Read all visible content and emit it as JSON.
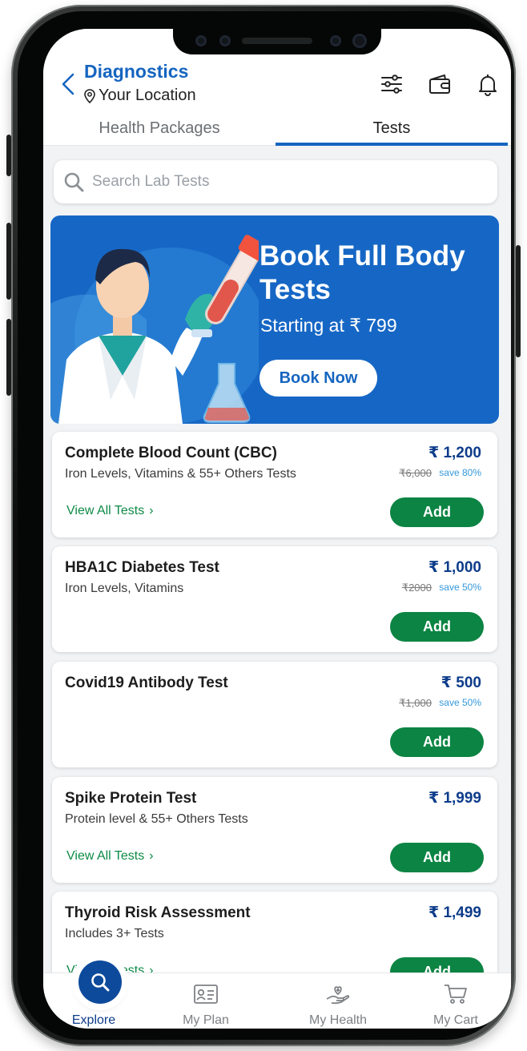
{
  "header": {
    "title": "Diagnostics",
    "location": "Your Location"
  },
  "tabs": [
    {
      "label": "Health Packages",
      "active": false
    },
    {
      "label": "Tests",
      "active": true
    }
  ],
  "search": {
    "placeholder": "Search Lab Tests"
  },
  "banner": {
    "title": "Book Full Body Tests",
    "subtitle": "Starting at ₹ 799",
    "button": "Book Now"
  },
  "tests": [
    {
      "name": "Complete Blood Count (CBC)",
      "description": "Iron Levels, Vitamins & 55+ Others Tests",
      "price": "₹ 1,200",
      "old_price": "₹6,000",
      "save": "save 80%",
      "view_all": "View All Tests",
      "add": "Add"
    },
    {
      "name": "HBA1C Diabetes Test",
      "description": "Iron Levels, Vitamins",
      "price": "₹ 1,000",
      "old_price": "₹2000",
      "save": "save 50%",
      "view_all": "",
      "add": "Add"
    },
    {
      "name": "Covid19 Antibody Test",
      "description": "",
      "price": "₹ 500",
      "old_price": "₹1,000",
      "save": "save 50%",
      "view_all": "",
      "add": "Add"
    },
    {
      "name": "Spike Protein Test",
      "description": "Protein level & 55+ Others Tests",
      "price": "₹ 1,999",
      "old_price": "",
      "save": "",
      "view_all": "View All Tests",
      "add": "Add"
    },
    {
      "name": "Thyroid Risk Assessment",
      "description": "Includes 3+ Tests",
      "price": "₹ 1,499",
      "old_price": "",
      "save": "",
      "view_all": "View All Tests",
      "add": "Add"
    }
  ],
  "bottom_nav": [
    {
      "label": "Explore",
      "icon": "search-icon",
      "active": true
    },
    {
      "label": "My Plan",
      "icon": "id-card-icon",
      "active": false
    },
    {
      "label": "My Health",
      "icon": "heart-hand-icon",
      "active": false
    },
    {
      "label": "My Cart",
      "icon": "cart-icon",
      "active": false
    }
  ],
  "colors": {
    "primary": "#1565c0",
    "banner": "#1667c5",
    "add_button": "#0c8443",
    "price": "#0d3c8a",
    "save": "#3498db"
  }
}
